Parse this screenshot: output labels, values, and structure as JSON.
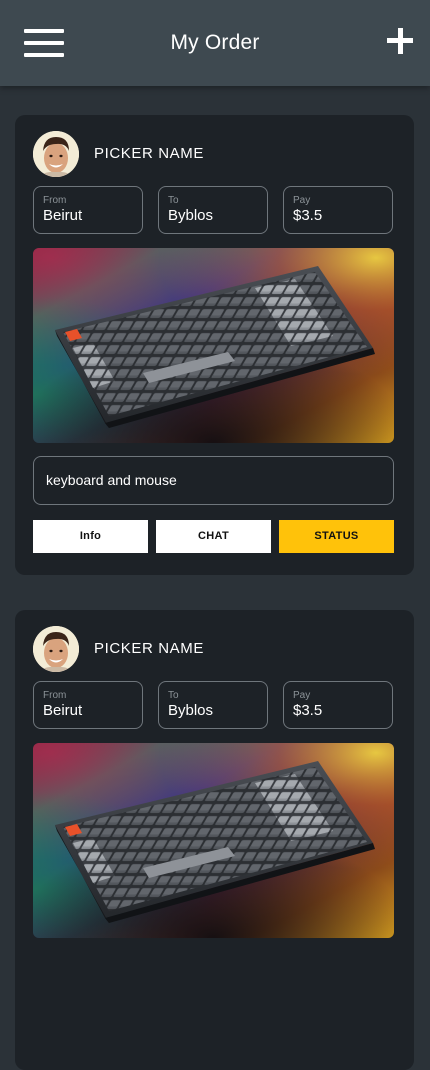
{
  "header": {
    "title": "My Order",
    "menu_icon": "hamburger-menu-icon",
    "add_icon": "plus-icon"
  },
  "orders": [
    {
      "picker_name": "PICKER NAME",
      "from": {
        "label": "From",
        "value": "Beirut"
      },
      "to": {
        "label": "To",
        "value": "Byblos"
      },
      "pay": {
        "label": "Pay",
        "value": "$3.5"
      },
      "description": "keyboard and mouse",
      "buttons": {
        "info": "Info",
        "chat": "CHAT",
        "status": "STATUS"
      }
    },
    {
      "picker_name": "PICKER NAME",
      "from": {
        "label": "From",
        "value": "Beirut"
      },
      "to": {
        "label": "To",
        "value": "Byblos"
      },
      "pay": {
        "label": "Pay",
        "value": "$3.5"
      }
    }
  ],
  "colors": {
    "background": "#2b3238",
    "header": "#3e4950",
    "card": "#1d2227",
    "status_button": "#ffc20a"
  }
}
